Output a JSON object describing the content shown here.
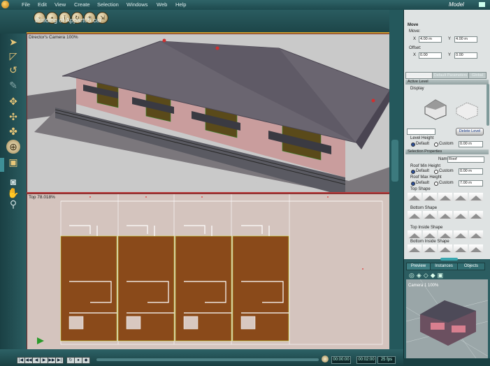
{
  "app": {
    "name": "Model"
  },
  "menu": [
    "File",
    "Edit",
    "View",
    "Create",
    "Selection",
    "Windows",
    "Web",
    "Help"
  ],
  "document": {
    "title": "Building of Appart05.car"
  },
  "viewports": {
    "camera_label": "Director's Camera 100%",
    "top_label": "Top 78.018%"
  },
  "panel": {
    "section_title": "Move",
    "move": {
      "label": "Move:",
      "x_label": "X",
      "x_value": "4.00 m",
      "y_label": "Y",
      "y_value": "4.00 m"
    },
    "offset": {
      "label": "Offset:",
      "x_label": "X",
      "x_value": "0.00",
      "y_label": "Y",
      "y_value": "0.00"
    },
    "tabs": [
      "Modelisation",
      "Default Parameters",
      "Global"
    ],
    "active_level": "Active Level",
    "display": "Display",
    "delete_level": "Delete Level",
    "level_height": {
      "title": "Level Height",
      "default": "Default",
      "custom": "Custom",
      "value": "0.00 m"
    },
    "selection_properties": "Selection Properties",
    "name": {
      "label": "Name:",
      "value": "Roof"
    },
    "roof_min_height": {
      "title": "Roof Min Height",
      "default": "Default",
      "custom": "Custom",
      "value": "0.00 m"
    },
    "roof_max_height": {
      "title": "Roof Max Height",
      "default": "Default",
      "custom": "Custom",
      "value": "7.00 m"
    },
    "shape_sections": [
      "Top Shape",
      "Bottom Shape",
      "Top Inside Shape",
      "Bottom Inside Shape"
    ]
  },
  "preview": {
    "tabs": [
      "Preview",
      "Instances",
      "Objects"
    ],
    "camera_label": "Camera 1 100%"
  },
  "timeline": {
    "current_time": "00:00:00",
    "end_time": "00:02:00",
    "fps": "25 fps"
  },
  "colors": {
    "accent": "#c89a30",
    "chrome": "#24585c",
    "roof": "#6a6570",
    "wall": "#c9a0a0",
    "floor": "#8a4a1a"
  }
}
